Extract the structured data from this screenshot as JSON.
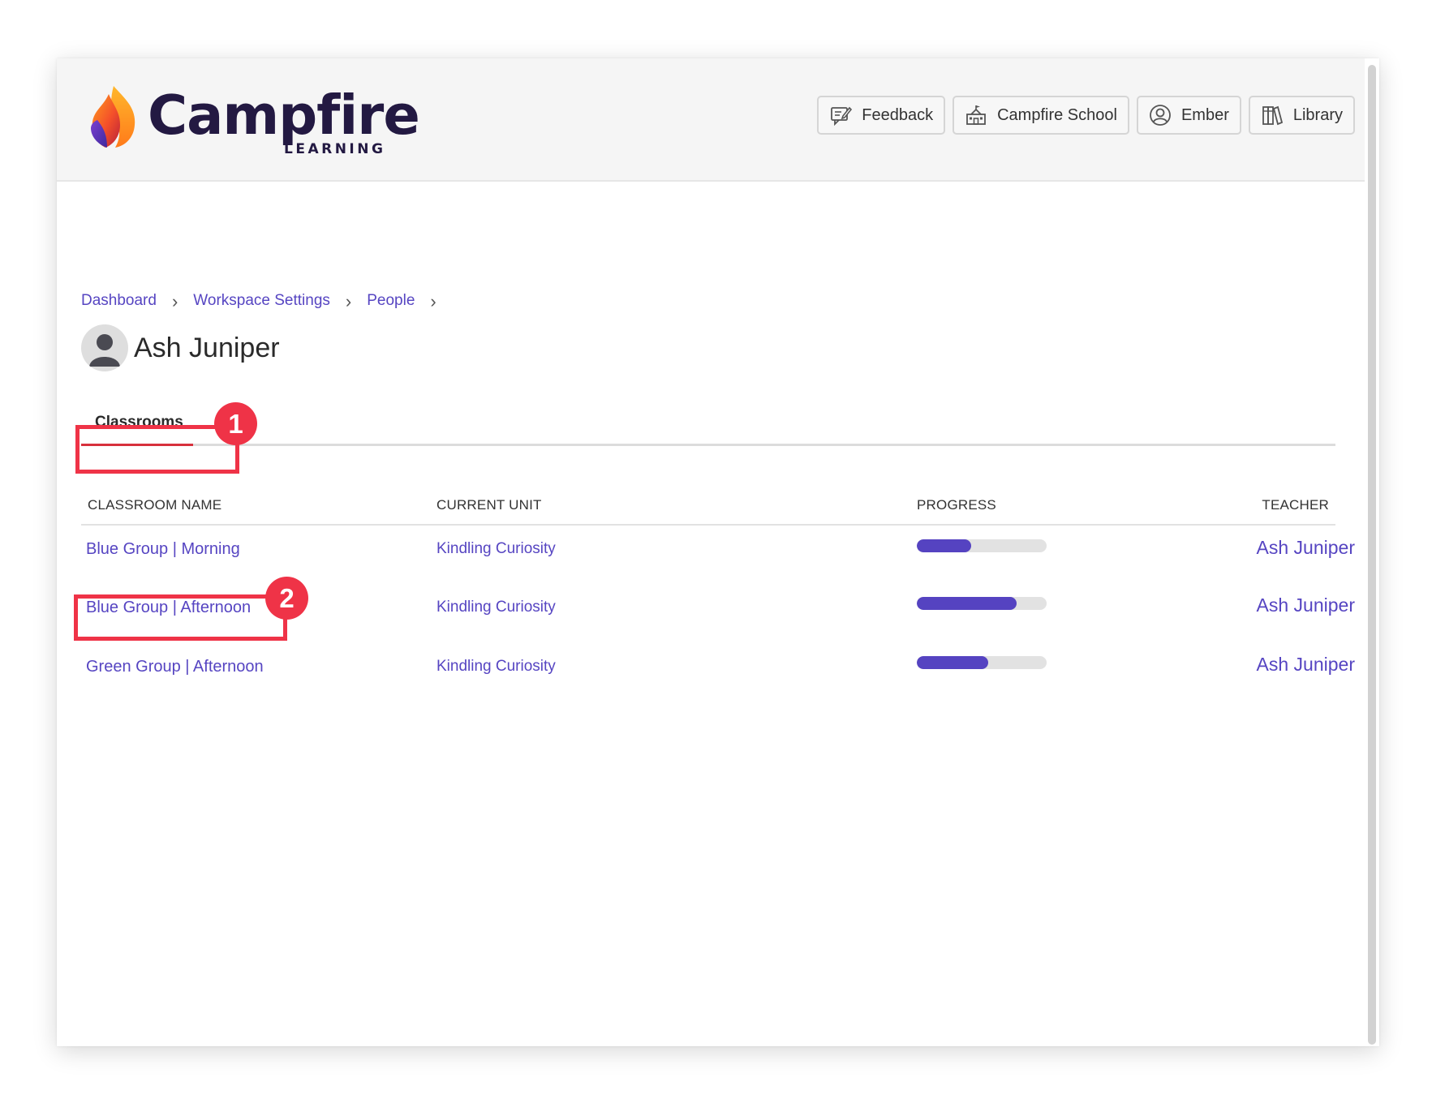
{
  "app": {
    "brand": "Campfire",
    "brand_sub": "LEARNING"
  },
  "topnav": [
    {
      "label": "Feedback",
      "icon": "feedback-icon"
    },
    {
      "label": "Campfire School",
      "icon": "school-icon"
    },
    {
      "label": "Ember",
      "icon": "user-circle-icon"
    },
    {
      "label": "Library",
      "icon": "books-icon"
    }
  ],
  "breadcrumb": [
    "Dashboard",
    "Workspace Settings",
    "People"
  ],
  "person": {
    "name": "Ash Juniper"
  },
  "tabs": [
    {
      "label": "Classrooms",
      "active": true
    }
  ],
  "table": {
    "headers": [
      "CLASSROOM NAME",
      "CURRENT UNIT",
      "PROGRESS",
      "TEACHER"
    ],
    "rows": [
      {
        "classroom": "Blue Group | Morning",
        "unit": "Kindling Curiosity",
        "progress": 0.42,
        "teacher": "Ash Juniper"
      },
      {
        "classroom": "Blue Group | Afternoon",
        "unit": "Kindling Curiosity",
        "progress": 0.77,
        "teacher": "Ash Juniper"
      },
      {
        "classroom": "Green Group | Afternoon",
        "unit": "Kindling Curiosity",
        "progress": 0.55,
        "teacher": "Ash Juniper"
      }
    ]
  },
  "annotations": [
    {
      "number": "1",
      "target": "CLASSROOM NAME"
    },
    {
      "number": "2",
      "target": "Green Group | Afternoon"
    }
  ],
  "colors": {
    "accent": "#5645c2",
    "progress_fill": "#5543c1",
    "tab_active": "#d7303c",
    "annotation": "#ef3347",
    "brand_text": "#231942"
  }
}
